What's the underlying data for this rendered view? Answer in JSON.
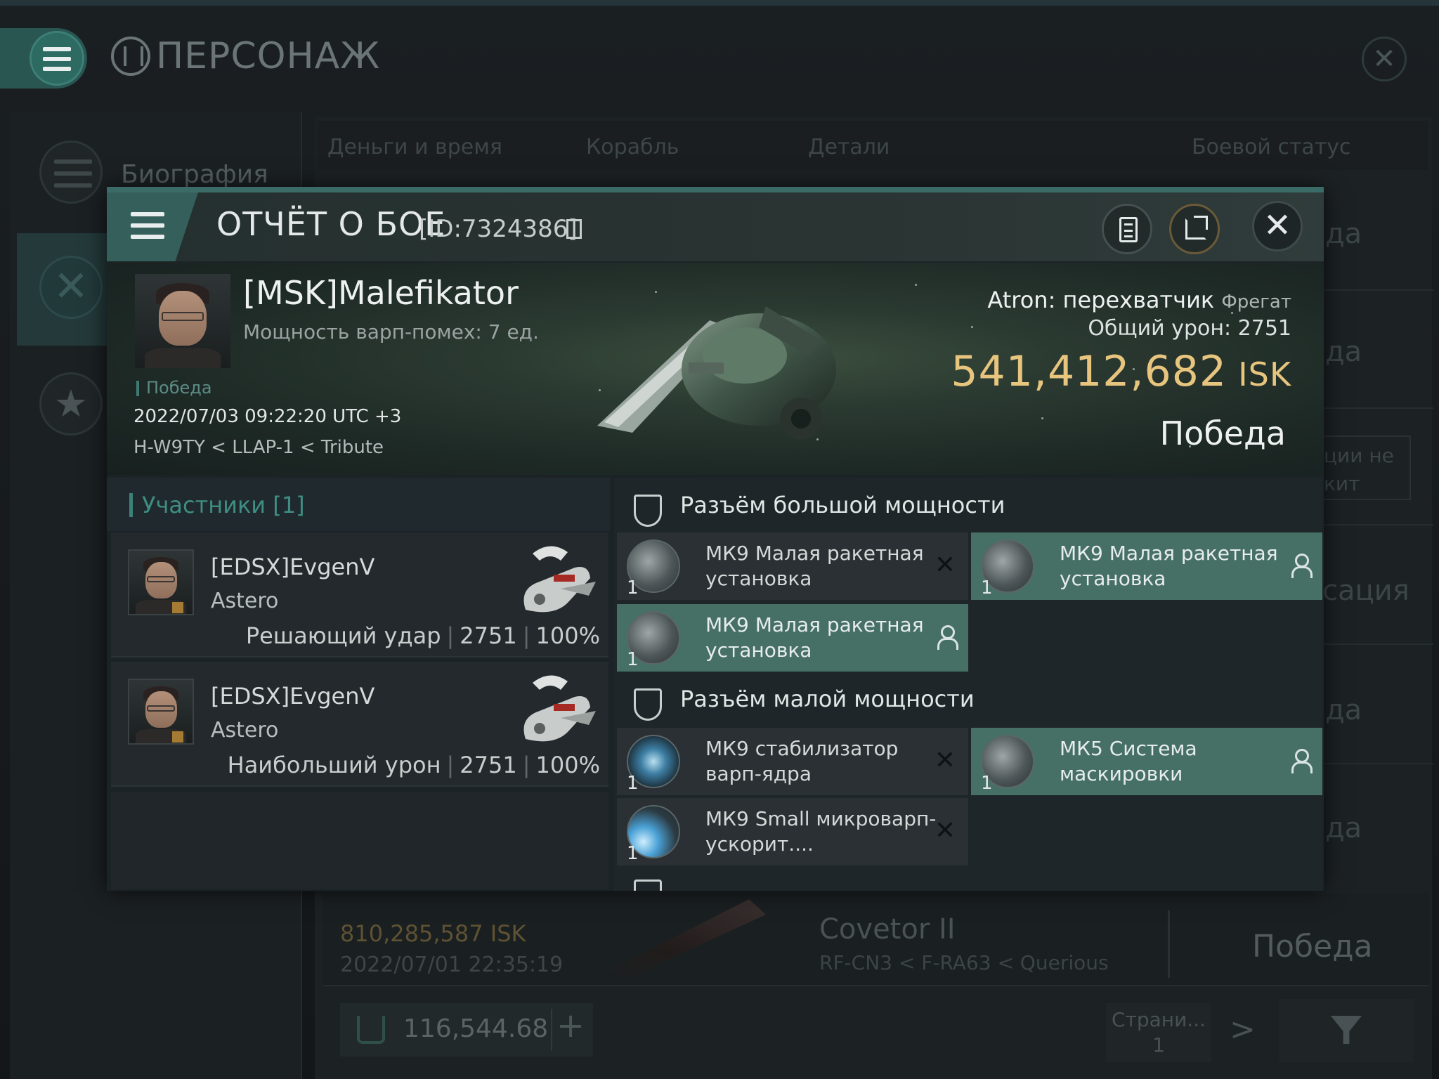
{
  "background_page": {
    "title": "ПЕРСОНАЖ",
    "sidebar": {
      "biography_label": "Биография"
    },
    "tabs": [
      "Деньги и время",
      "Корабль",
      "Детали",
      "Боевой статус"
    ],
    "right_col_texts": [
      "да",
      "да",
      "ции не",
      "кит",
      "сация",
      "да",
      "да"
    ],
    "row": {
      "isk": "810,285,587",
      "isk_unit": "ISK",
      "date": "2022/07/01  22:35:19",
      "ship": "Covetor II",
      "location": "RF-CN3 < F-RA63 < Querious",
      "result": "Победа"
    },
    "wallet": {
      "value": "116,544.68",
      "plus": "+"
    },
    "pager": {
      "label": "Страни...",
      "page": "1",
      "next": ">"
    }
  },
  "report": {
    "title": "ОТЧЁТ О БОЕ",
    "id": "[ID:7324386]",
    "close": "✕",
    "victim": {
      "name": "[MSK]Malefikator",
      "warp_disruption": "Мощность варп-помех: 7 ед.",
      "status": "Победа",
      "datetime": "2022/07/03 09:22:20 UTC +3",
      "location": "H-W9TY < LLAP-1 < Tribute",
      "ship": "Atron: перехватчик",
      "ship_class": "Фрегат",
      "damage_label": "Общий урон:",
      "damage_value": "2751",
      "isk_value": "541,412,682",
      "isk_unit": "ISK",
      "result": "Победа"
    },
    "participants": {
      "header": "Участники [1]",
      "list": [
        {
          "name": "[EDSX]EvgenV",
          "ship": "Astero",
          "role": "Решающий удар",
          "damage": "2751",
          "percent": "100%"
        },
        {
          "name": "[EDSX]EvgenV",
          "ship": "Astero",
          "role": "Наибольший урон",
          "damage": "2751",
          "percent": "100%"
        }
      ]
    },
    "fittings": {
      "high": {
        "header": "Разъём большой мощности",
        "modules": [
          {
            "name": "МК9 Малая ракетная установка",
            "qty": "1",
            "state": "destroyed"
          },
          {
            "name": "МК9 Малая ракетная установка",
            "qty": "1",
            "state": "dropped"
          },
          {
            "name": "МК9 Малая ракетная установка",
            "qty": "1",
            "state": "dropped"
          }
        ]
      },
      "low": {
        "header": "Разъём малой мощности",
        "modules": [
          {
            "name": "МК9 стабилизатор варп-ядра",
            "qty": "1",
            "state": "destroyed"
          },
          {
            "name": "МК5 Система маскировки",
            "qty": "1",
            "state": "dropped"
          },
          {
            "name": "МК9 Small микроварп-ускорит....",
            "qty": "1",
            "state": "destroyed"
          }
        ]
      }
    }
  }
}
